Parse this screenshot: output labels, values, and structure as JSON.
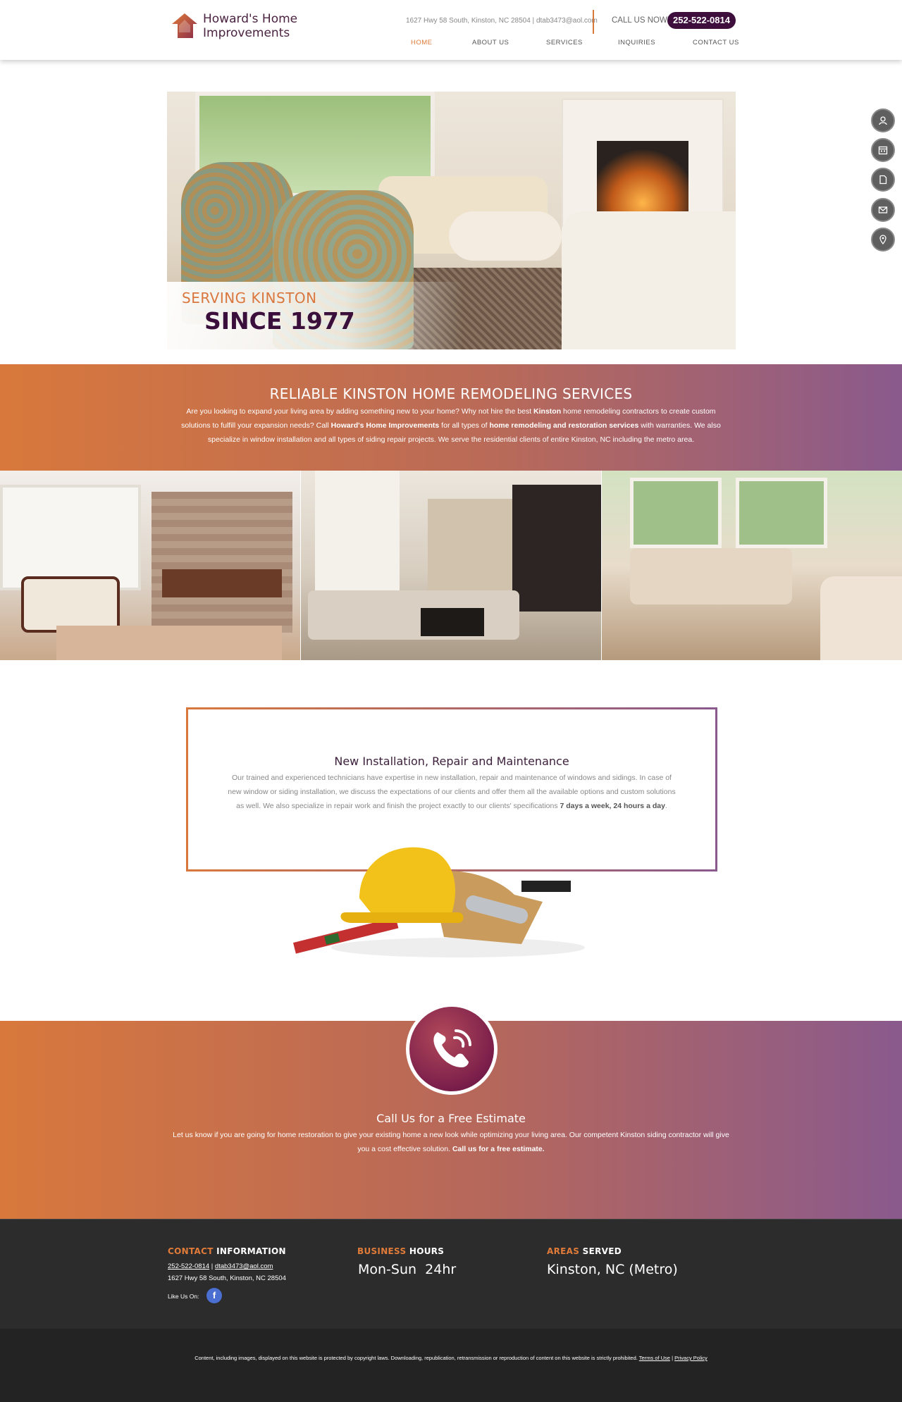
{
  "brand": {
    "line1": "Howard's Home",
    "line2": "Improvements"
  },
  "header": {
    "address": "1627 Hwy 58 South, Kinston, NC 28504",
    "sep": " | ",
    "email": "dtab3473@aol.com",
    "call_label": "CALL US NOW!",
    "phone": "252-522-0814"
  },
  "nav": [
    {
      "label": "HOME",
      "active": true
    },
    {
      "label": "ABOUT US"
    },
    {
      "label": "SERVICES"
    },
    {
      "label": "INQUIRIES"
    },
    {
      "label": "CONTACT US"
    }
  ],
  "hero": {
    "serving": "SERVING KINSTON",
    "since": "SINCE 1977"
  },
  "side_icons": [
    "user-icon",
    "calendar-icon",
    "document-icon",
    "mail-icon",
    "location-pin-icon"
  ],
  "intro": {
    "title": "RELIABLE KINSTON HOME REMODELING SERVICES",
    "t1": "Are you looking to expand your living area by adding something new to your home? Why not hire the best ",
    "b1": "Kinston",
    "t2": " home remodeling contractors to create custom solutions to fulfill your expansion needs? Call ",
    "b2": "Howard's Home Improvements",
    "t3": " for all types of ",
    "b3": "home remodeling and restoration services",
    "t4": " with warranties. We also specialize in window installation and all types of siding repair projects. We serve the residential clients of entire Kinston, NC including the metro area."
  },
  "service": {
    "title": "New Installation, Repair and Maintenance",
    "text": "Our trained and experienced technicians have expertise in new installation, repair and maintenance of windows and sidings. In case of new window or siding installation, we discuss the expectations of our clients and offer them all the available options and custom solutions as well. We also specialize in repair work and finish the project exactly to our clients' specifications ",
    "bold": "7 days a week, 24 hours a day",
    "end": "."
  },
  "estimate": {
    "title": "Call Us for a Free Estimate",
    "text": "Let us know if you are going for home restoration to give your existing home a new look while optimizing your living area. Our competent Kinston siding contractor will give you a cost effective solution. ",
    "bold": "Call us for a free estimate."
  },
  "footer": {
    "contact_accent": "CONTACT",
    "contact_rest": " INFORMATION",
    "phone": "252-522-0814",
    "sep": " | ",
    "email": "dtab3473@aol.com",
    "address": "1627 Hwy 58 South, Kinston, NC 28504",
    "like": "Like Us On:",
    "fb": "f",
    "hours_accent": "BUSINESS",
    "hours_rest": " HOURS",
    "hours": "Mon-Sun  24hr",
    "areas_accent": "AREAS",
    "areas_rest": " SERVED",
    "areas": "Kinston, NC (Metro)"
  },
  "copyright": {
    "text": "Content, including images, displayed on this website is protected by copyright laws. Downloading, republication, retransmission or reproduction of content on this website is strictly prohibited. ",
    "terms": "Terms of Use",
    "sep": " | ",
    "privacy": "Privacy Policy"
  },
  "colors": {
    "accent": "#e07b39",
    "purple": "#3e0e3c",
    "gradient_end": "#8a5a8d"
  }
}
